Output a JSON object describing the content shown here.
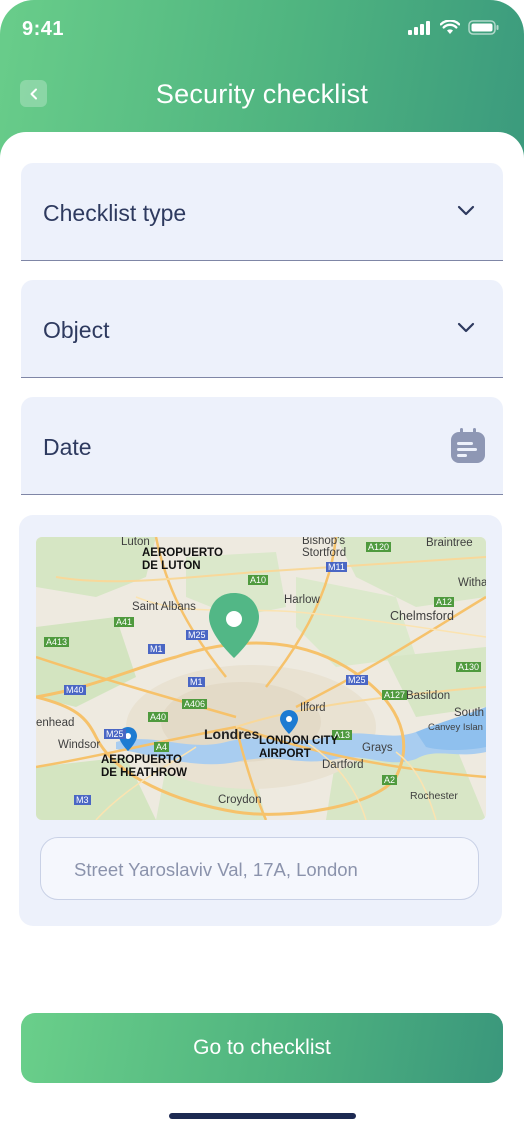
{
  "status_bar": {
    "time": "9:41"
  },
  "nav": {
    "title": "Security checklist"
  },
  "fields": {
    "checklist_type": "Checklist type",
    "object": "Object",
    "date": "Date"
  },
  "map": {
    "labels": {
      "luton": "Luton",
      "luton_airport": "AEROPUERTO DE LUTON",
      "bishops_stortford": "Bishop's Stortford",
      "braintree": "Braintree",
      "witham": "Witha",
      "saint_albans": "Saint Albans",
      "harlow": "Harlow",
      "chelmsford": "Chelmsford",
      "basildon": "Basildon",
      "south": "South",
      "canvey": "Canvey Islan",
      "henhead": "enhead",
      "windsor": "Windsor",
      "heathrow": "AEROPUERTO DE HEATHROW",
      "londres": "Londres",
      "london_city": "LONDON CITY AIRPORT",
      "ilford": "Ilford",
      "grays": "Grays",
      "dartford": "Dartford",
      "rochester": "Rochester",
      "croydon": "Croydon"
    },
    "roads": {
      "a120": "A120",
      "m11": "M11",
      "a10": "A10",
      "a12": "A12",
      "a41": "A41",
      "a413": "A413",
      "m1": "M1",
      "m25": "M25",
      "m1b": "M1",
      "a406": "A406",
      "m40": "M40",
      "a40": "A40",
      "m25b": "M25",
      "a4": "A4",
      "a127": "A127",
      "a13": "A13",
      "a2": "A2",
      "m3": "M3",
      "m25c": "M25",
      "a130": "A130"
    }
  },
  "address": {
    "value": "Street Yaroslaviv Val, 17A, London"
  },
  "cta": {
    "label": "Go to checklist"
  },
  "colors": {
    "accent_start": "#69cd8a",
    "accent_end": "#3b9a7d",
    "field_bg": "#edf1fb",
    "text_dark": "#2e3a5f"
  }
}
